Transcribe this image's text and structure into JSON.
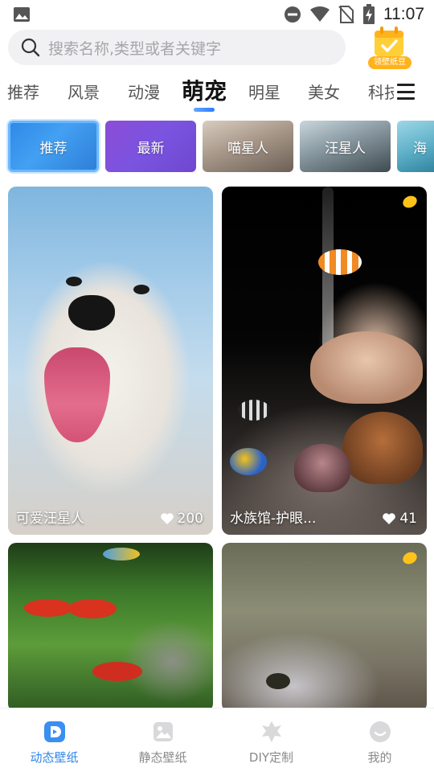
{
  "status_bar": {
    "time": "11:07",
    "icons": [
      "image-icon",
      "dnd-icon",
      "wifi-icon",
      "no-sim-icon",
      "battery-charging-icon"
    ]
  },
  "search": {
    "placeholder": "搜索名称,类型或者关键字",
    "icon": "search-icon"
  },
  "promo_badge": {
    "label": "领壁纸豆"
  },
  "category_tabs": [
    {
      "label": "推荐",
      "active": false
    },
    {
      "label": "风景",
      "active": false
    },
    {
      "label": "动漫",
      "active": false
    },
    {
      "label": "萌宠",
      "active": true
    },
    {
      "label": "明星",
      "active": false
    },
    {
      "label": "美女",
      "active": false
    },
    {
      "label": "科技",
      "active": false
    }
  ],
  "sub_chips": [
    {
      "label": "推荐",
      "selected": true
    },
    {
      "label": "最新",
      "selected": false
    },
    {
      "label": "喵星人",
      "selected": false
    },
    {
      "label": "汪星人",
      "selected": false
    },
    {
      "label": "海",
      "selected": false
    }
  ],
  "wallpapers": [
    {
      "title": "可爱汪星人",
      "likes": "200",
      "dynamic": false
    },
    {
      "title": "水族馆-护眼...",
      "likes": "41",
      "dynamic": true
    },
    {
      "title": "",
      "likes": "",
      "dynamic": false
    },
    {
      "title": "",
      "likes": "",
      "dynamic": true
    }
  ],
  "bottom_nav": [
    {
      "label": "动态壁纸",
      "icon": "dynamic-wallpaper-icon",
      "active": true
    },
    {
      "label": "静态壁纸",
      "icon": "static-wallpaper-icon",
      "active": false
    },
    {
      "label": "DIY定制",
      "icon": "diy-icon",
      "active": false
    },
    {
      "label": "我的",
      "icon": "profile-icon",
      "active": false
    }
  ],
  "colors": {
    "accent": "#2f86e8",
    "inactive": "#8a8a8a",
    "badge": "#ffb21c"
  }
}
